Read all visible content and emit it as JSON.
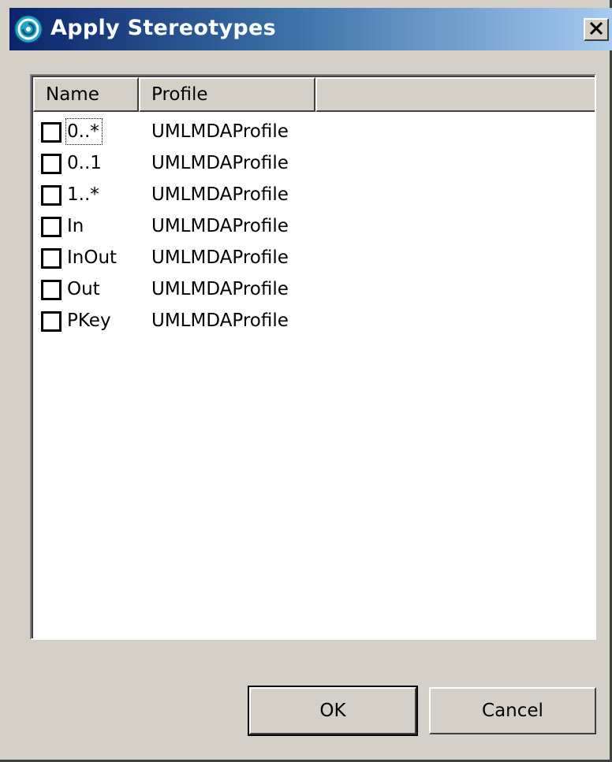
{
  "window": {
    "title": "Apply Stereotypes",
    "colors": {
      "titlebar_start": "#0a246a",
      "titlebar_end": "#a6caf0",
      "face": "#d4d0c8"
    }
  },
  "icons": {
    "app": "eclipse-swirl-icon",
    "close": "close-x-icon"
  },
  "table": {
    "columns": [
      "Name",
      "Profile",
      ""
    ],
    "rows": [
      {
        "name": "0..*",
        "profile": "UMLMDAProfile",
        "checked": false,
        "focused": true
      },
      {
        "name": "0..1",
        "profile": "UMLMDAProfile",
        "checked": false,
        "focused": false
      },
      {
        "name": "1..*",
        "profile": "UMLMDAProfile",
        "checked": false,
        "focused": false
      },
      {
        "name": "In",
        "profile": "UMLMDAProfile",
        "checked": false,
        "focused": false
      },
      {
        "name": "InOut",
        "profile": "UMLMDAProfile",
        "checked": false,
        "focused": false
      },
      {
        "name": "Out",
        "profile": "UMLMDAProfile",
        "checked": false,
        "focused": false
      },
      {
        "name": "PKey",
        "profile": "UMLMDAProfile",
        "checked": false,
        "focused": false
      }
    ]
  },
  "buttons": {
    "ok": "OK",
    "cancel": "Cancel"
  }
}
